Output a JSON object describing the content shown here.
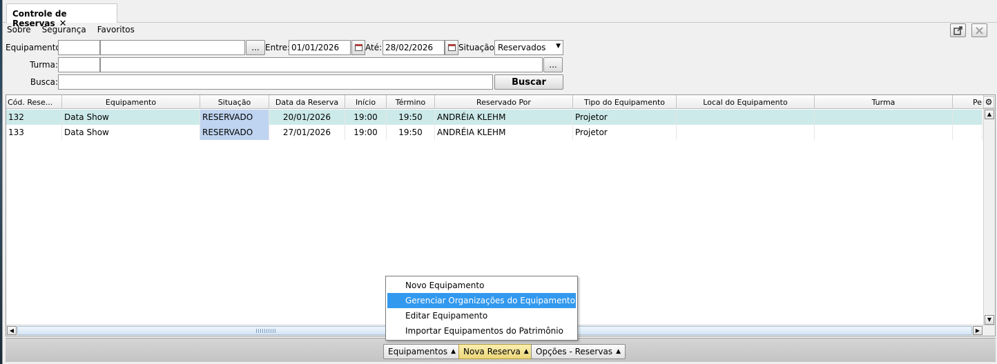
{
  "tab": {
    "title": "Controle de Reservas",
    "close_glyph": "✕"
  },
  "menu": [
    "Sobre",
    "Segurança",
    "Favoritos"
  ],
  "filters": {
    "equipamento_label": "Equipamento:",
    "equipamento_code": "",
    "equipamento_name": "",
    "browse_label": "...",
    "entre_label": "Entre:",
    "entre_value": "01/01/2026",
    "ate_label": "Até:",
    "ate_value": "28/02/2026",
    "situacao_label": "Situação:",
    "situacao_value": "Reservados",
    "turma_label": "Turma:",
    "turma_code": "",
    "turma_name": "",
    "busca_label": "Busca:",
    "busca_value": "",
    "buscar_button": "Buscar"
  },
  "grid": {
    "columns": [
      "Cód. Rese...",
      "Equipamento",
      "Situação",
      "Data da Reserva",
      "Início",
      "Término",
      "Reservado Por",
      "Tipo do Equipamento",
      "Local do Equipamento",
      "Turma",
      "Pe"
    ],
    "rows": [
      {
        "codigo": "132",
        "equipamento": "Data Show",
        "situacao": "RESERVADO",
        "data": "20/01/2026",
        "inicio": "19:00",
        "termino": "19:50",
        "reservado_por": "ANDRÉIA KLEHM",
        "tipo": "Projetor",
        "local": "",
        "turma": "",
        "pe": ""
      },
      {
        "codigo": "133",
        "equipamento": "Data Show",
        "situacao": "RESERVADO",
        "data": "27/01/2026",
        "inicio": "19:00",
        "termino": "19:50",
        "reservado_por": "ANDRÉIA KLEHM",
        "tipo": "Projetor",
        "local": "",
        "turma": "",
        "pe": ""
      }
    ],
    "selected_row_color": "#cdeaea",
    "status_cell_color": "#bfd4f0"
  },
  "popup_menu": {
    "items": [
      "Novo Equipamento",
      "Gerenciar Organizações do Equipamento",
      "Editar Equipamento",
      "Importar Equipamentos do Patrimônio"
    ],
    "highlighted_index": 1,
    "highlight_color": "#3399ee"
  },
  "bottom_buttons": [
    "Equipamentos",
    "Nova Reserva",
    "Opções - Reservas"
  ],
  "icons": {
    "popout": "popout-icon",
    "close": "close-icon",
    "calendar": "calendar-icon",
    "gear": "gear-icon",
    "caret": "caret-up-icon"
  }
}
